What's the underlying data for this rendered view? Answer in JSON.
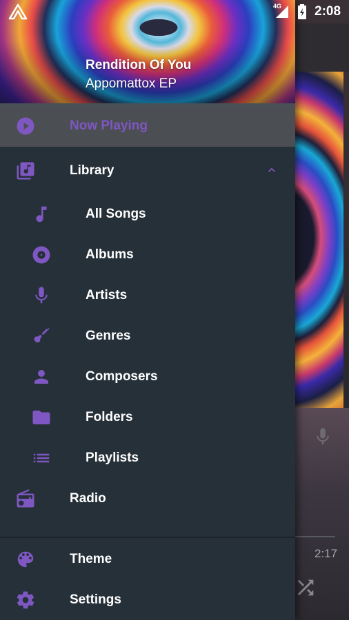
{
  "status_bar": {
    "network": "4G",
    "time": "2:08"
  },
  "drawer": {
    "header": {
      "song_title": "Rendition Of You",
      "album": "Appomattox EP"
    },
    "items": [
      {
        "label": "Now Playing",
        "icon": "now-playing-disc-icon",
        "selected": true
      },
      {
        "label": "Library",
        "icon": "library-music-icon",
        "expanded": true
      },
      {
        "label": "All Songs",
        "icon": "music-note-icon"
      },
      {
        "label": "Albums",
        "icon": "album-disc-icon"
      },
      {
        "label": "Artists",
        "icon": "microphone-icon"
      },
      {
        "label": "Genres",
        "icon": "guitar-icon"
      },
      {
        "label": "Composers",
        "icon": "person-icon"
      },
      {
        "label": "Folders",
        "icon": "folder-icon"
      },
      {
        "label": "Playlists",
        "icon": "playlist-icon"
      },
      {
        "label": "Radio",
        "icon": "radio-icon"
      },
      {
        "label": "Theme",
        "icon": "palette-icon"
      },
      {
        "label": "Settings",
        "icon": "gear-icon"
      }
    ]
  },
  "player_background": {
    "elapsed_time": "2:17"
  },
  "colors": {
    "accent": "#7e57c2",
    "drawer_background": "#263039",
    "selected_background": "#4b4f53"
  }
}
